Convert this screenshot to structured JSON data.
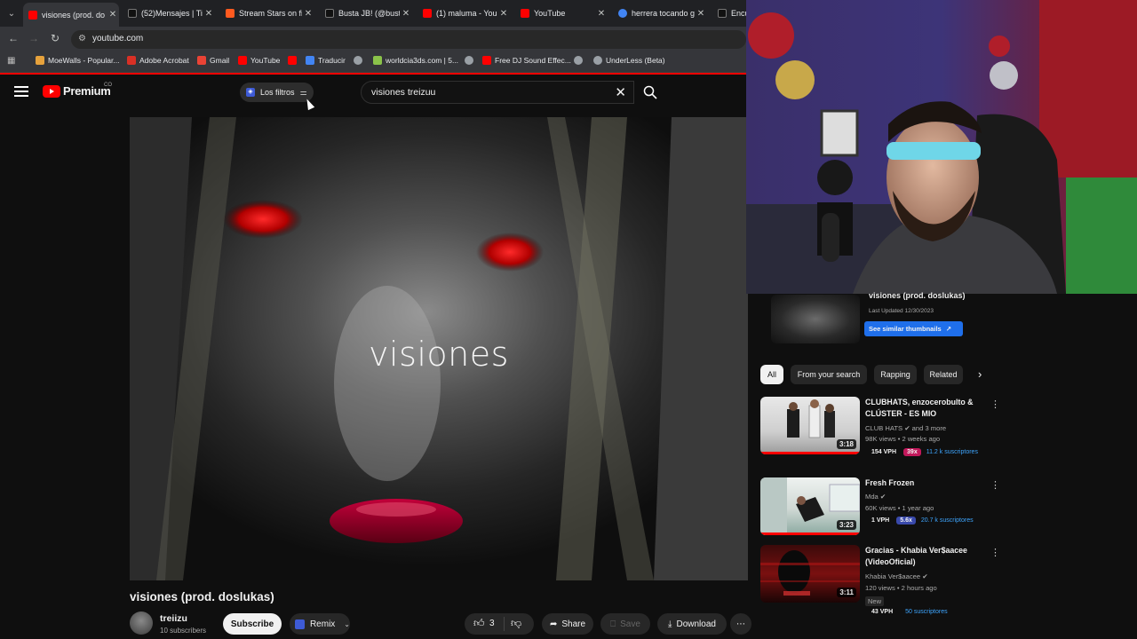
{
  "browser": {
    "tabs": [
      {
        "title": "visiones (prod. do",
        "favicon_color": "#ff0000",
        "active": true
      },
      {
        "title": "(52)Mensajes | Tik",
        "favicon_color": "#111111",
        "active": false
      },
      {
        "title": "Stream Stars on fi",
        "favicon_color": "#ff5a1f",
        "active": false
      },
      {
        "title": "Busta JB! (@busta",
        "favicon_color": "#111111",
        "active": false
      },
      {
        "title": "(1) maluma - You",
        "favicon_color": "#ff0000",
        "active": false
      },
      {
        "title": "YouTube",
        "favicon_color": "#ff0000",
        "active": false
      },
      {
        "title": "herrera tocando g",
        "favicon_color": "#4285f4",
        "active": false
      },
      {
        "title": "Encu",
        "favicon_color": "#111111",
        "active": false
      }
    ],
    "url": "youtube.com",
    "bookmarks": [
      {
        "label": "MoeWalls - Popular...",
        "color": "#e6a23c"
      },
      {
        "label": "Adobe Acrobat",
        "color": "#d93025"
      },
      {
        "label": "Gmail",
        "color": "#ea4335"
      },
      {
        "label": "YouTube",
        "color": "#ff0000"
      },
      {
        "label": "",
        "color": "#ff0000"
      },
      {
        "label": "Traducir",
        "color": "#4285f4"
      },
      {
        "label": "",
        "color": "#9aa0a6"
      },
      {
        "label": "worldcia3ds.com | 5...",
        "color": "#8bc34a"
      },
      {
        "label": "",
        "color": "#9aa0a6"
      },
      {
        "label": "Free DJ Sound Effec...",
        "color": "#ff0000"
      },
      {
        "label": "",
        "color": "#9aa0a6"
      },
      {
        "label": "UnderLess (Beta)",
        "color": "#9aa0a6"
      }
    ]
  },
  "youtube": {
    "logo_text": "Premium",
    "country_code": "CO",
    "filter_chip": "Los filtros",
    "search_query": "visiones treizuu"
  },
  "video": {
    "overlay_text": "visiones",
    "title": "visiones (prod. doslukas)",
    "channel": "treiizu",
    "subscribers": "10 subscribers",
    "subscribe_label": "Subscribe",
    "remix_label": "Remix",
    "likes": "3",
    "share_label": "Share",
    "save_label": "Save",
    "download_label": "Download"
  },
  "sidebar": {
    "playlist": {
      "title": "visiones (prod. doslukas)",
      "updated": "Last Updated 12/30/2023",
      "button": "See similar thumbnails"
    },
    "chips": [
      "All",
      "From your search",
      "Rapping",
      "Related"
    ],
    "recommendations": [
      {
        "title": "CLUBHATS, enzocerobulto & CLÚSTER - ES MIO",
        "channel": "CLUB HATS",
        "channel_extra": "and 3 more",
        "meta": "98K views • 2 weeks ago",
        "duration": "3:18",
        "vph": "154 VPH",
        "multiplier": "39x",
        "multiplier_color": "#c2185b",
        "subs": "11.2 k suscriptores",
        "is_new": false
      },
      {
        "title": "Fresh Frozen",
        "channel": "Mda",
        "channel_extra": "",
        "meta": "60K views • 1 year ago",
        "duration": "3:23",
        "vph": "1 VPH",
        "multiplier": "5.6x",
        "multiplier_color": "#3949ab",
        "subs": "20.7 k suscriptores",
        "is_new": false
      },
      {
        "title": "Gracias - Khabia Ver$aacee (VideoOficial)",
        "channel": "Khabia Ver$aacee",
        "channel_extra": "",
        "meta": "120 views • 2 hours ago",
        "duration": "3:11",
        "vph": "43 VPH",
        "multiplier": "",
        "multiplier_color": "#3949ab",
        "subs": "50 suscriptores",
        "is_new": true,
        "new_label": "New"
      }
    ]
  }
}
